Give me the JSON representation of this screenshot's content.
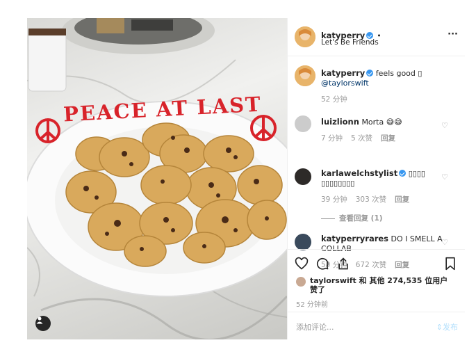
{
  "header": {
    "username": "katyperry",
    "dot": "•",
    "subtitle": "Let's Be Friends",
    "more": "···"
  },
  "photo": {
    "plate_text": "PEACE AT LAST",
    "icons": {
      "tag": "person-icon"
    },
    "colors": {
      "icing": "#d8232a",
      "cookie": "#d9a95c"
    }
  },
  "caption": {
    "username": "katyperry",
    "text": "feels good ▯",
    "mention": "@taylorswift",
    "time": "52 分钟"
  },
  "comments": [
    {
      "username": "luizlionn",
      "text": "Morta 😅😅",
      "time": "7 分钟",
      "likes": "5 次赞",
      "reply": "回复"
    },
    {
      "username": "karlawelchstylist",
      "text": "▯▯▯▯ ▯▯▯▯▯▯▯▯",
      "time": "39 分钟",
      "likes": "303 次赞",
      "reply": "回复",
      "view_replies": "查看回复 (1)"
    },
    {
      "username": "katyperryrares",
      "text": "DO I SMELL A COLLAB",
      "time": "50 分钟",
      "likes": "672 次赞",
      "reply": "回复"
    }
  ],
  "likes": {
    "user": "taylorswift",
    "text": "和 其他 274,535 位用户赞了"
  },
  "timestamp": "52 分钟前",
  "add_comment": {
    "placeholder": "添加评论...",
    "post": "发布"
  },
  "icons": [
    "heart-icon",
    "comment-icon",
    "share-icon",
    "bookmark-icon"
  ],
  "colors": {
    "verified": "#3897f0",
    "meta": "#999999",
    "border": "#efefef"
  }
}
